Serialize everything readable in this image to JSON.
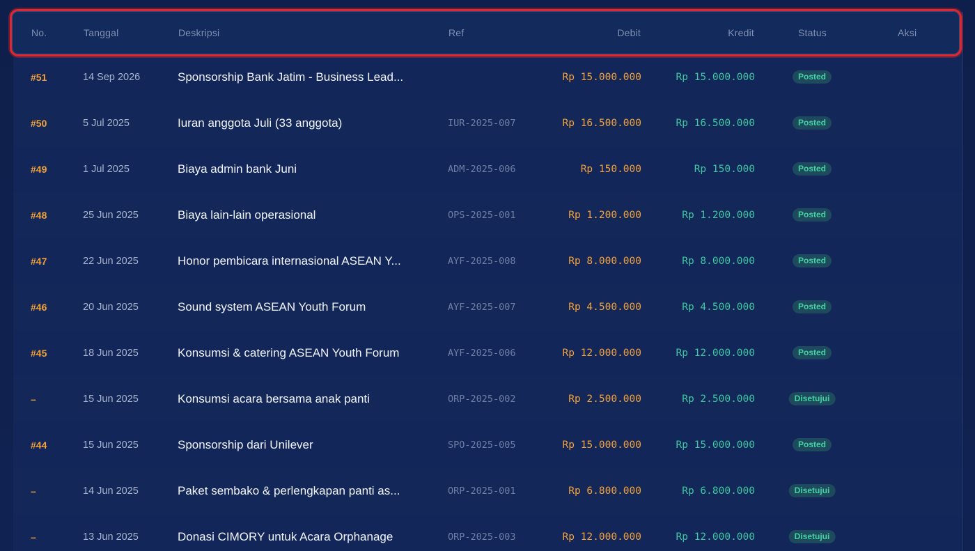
{
  "table": {
    "columns": {
      "no": "No.",
      "tanggal": "Tanggal",
      "deskripsi": "Deskripsi",
      "ref": "Ref",
      "debit": "Debit",
      "kredit": "Kredit",
      "status": "Status",
      "aksi": "Aksi"
    },
    "rows": [
      {
        "no": "#51",
        "tanggal": "14 Sep 2026",
        "deskripsi": "Sponsorship Bank Jatim - Business Lead...",
        "ref": "",
        "debit": "Rp 15.000.000",
        "kredit": "Rp 15.000.000",
        "status": "Posted"
      },
      {
        "no": "#50",
        "tanggal": "5 Jul 2025",
        "deskripsi": "Iuran anggota Juli (33 anggota)",
        "ref": "IUR-2025-007",
        "debit": "Rp 16.500.000",
        "kredit": "Rp 16.500.000",
        "status": "Posted"
      },
      {
        "no": "#49",
        "tanggal": "1 Jul 2025",
        "deskripsi": "Biaya admin bank Juni",
        "ref": "ADM-2025-006",
        "debit": "Rp 150.000",
        "kredit": "Rp 150.000",
        "status": "Posted"
      },
      {
        "no": "#48",
        "tanggal": "25 Jun 2025",
        "deskripsi": "Biaya lain-lain operasional",
        "ref": "OPS-2025-001",
        "debit": "Rp 1.200.000",
        "kredit": "Rp 1.200.000",
        "status": "Posted"
      },
      {
        "no": "#47",
        "tanggal": "22 Jun 2025",
        "deskripsi": "Honor pembicara internasional ASEAN Y...",
        "ref": "AYF-2025-008",
        "debit": "Rp 8.000.000",
        "kredit": "Rp 8.000.000",
        "status": "Posted"
      },
      {
        "no": "#46",
        "tanggal": "20 Jun 2025",
        "deskripsi": "Sound system ASEAN Youth Forum",
        "ref": "AYF-2025-007",
        "debit": "Rp 4.500.000",
        "kredit": "Rp 4.500.000",
        "status": "Posted"
      },
      {
        "no": "#45",
        "tanggal": "18 Jun 2025",
        "deskripsi": "Konsumsi & catering ASEAN Youth Forum",
        "ref": "AYF-2025-006",
        "debit": "Rp 12.000.000",
        "kredit": "Rp 12.000.000",
        "status": "Posted"
      },
      {
        "no": "–",
        "tanggal": "15 Jun 2025",
        "deskripsi": "Konsumsi acara bersama anak panti",
        "ref": "ORP-2025-002",
        "debit": "Rp 2.500.000",
        "kredit": "Rp 2.500.000",
        "status": "Disetujui"
      },
      {
        "no": "#44",
        "tanggal": "15 Jun 2025",
        "deskripsi": "Sponsorship dari Unilever",
        "ref": "SPO-2025-005",
        "debit": "Rp 15.000.000",
        "kredit": "Rp 15.000.000",
        "status": "Posted"
      },
      {
        "no": "–",
        "tanggal": "14 Jun 2025",
        "deskripsi": "Paket sembako & perlengkapan panti as...",
        "ref": "ORP-2025-001",
        "debit": "Rp 6.800.000",
        "kredit": "Rp 6.800.000",
        "status": "Disetujui"
      },
      {
        "no": "–",
        "tanggal": "13 Jun 2025",
        "deskripsi": "Donasi CIMORY untuk Acara Orphanage",
        "ref": "ORP-2025-003",
        "debit": "Rp 12.000.000",
        "kredit": "Rp 12.000.000",
        "status": "Disetujui"
      }
    ]
  },
  "colors": {
    "background": "#0f1f4a",
    "header_highlight": "#e3262e",
    "debit": "#f3a23a",
    "kredit": "#3ec7a0",
    "badge_bg": "#1d4a5c",
    "badge_text": "#46d3a4"
  }
}
